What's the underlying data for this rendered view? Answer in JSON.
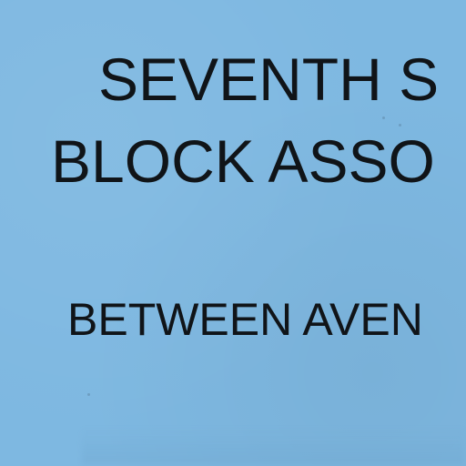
{
  "document": {
    "heading_line_1": "SEVENTH S",
    "heading_line_2": "BLOCK ASSO",
    "subheading": "BETWEEN AVEN"
  },
  "colors": {
    "paper": "#7eb8e1",
    "text": "#101418"
  }
}
